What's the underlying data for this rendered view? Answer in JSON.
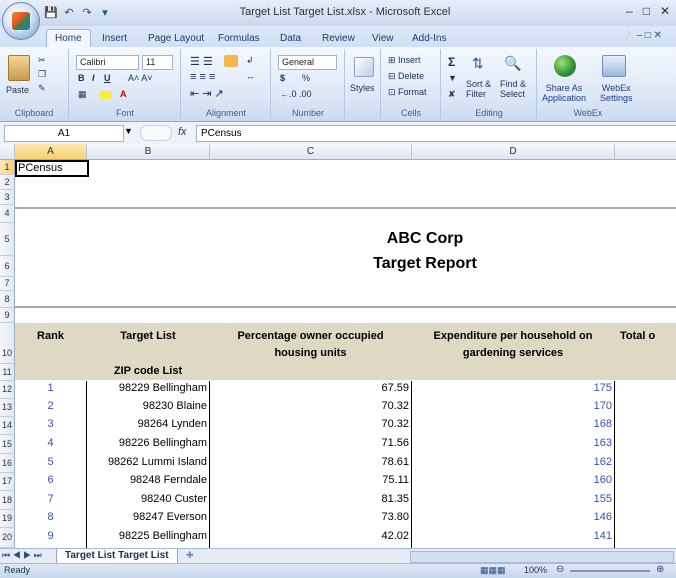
{
  "window": {
    "title": "Target List Target List.xlsx - Microsoft Excel"
  },
  "ribbon_tabs": [
    "Home",
    "Insert",
    "Page Layout",
    "Formulas",
    "Data",
    "Review",
    "View",
    "Add-Ins"
  ],
  "ribbon": {
    "clipboard": {
      "label": "Clipboard",
      "paste": "Paste"
    },
    "font": {
      "label": "Font",
      "name": "Calibri",
      "size": "11"
    },
    "alignment": {
      "label": "Alignment"
    },
    "number": {
      "label": "Number",
      "format": "General",
      "currency": "$",
      "percent": "%"
    },
    "styles": {
      "label": "Styles"
    },
    "cells": {
      "label": "Cells",
      "insert": "Insert",
      "delete": "Delete",
      "format": "Format"
    },
    "editing": {
      "label": "Editing",
      "sort": "Sort &",
      "filter": "Filter",
      "find": "Find &",
      "select": "Select"
    },
    "webex": {
      "label": "WebEx",
      "share": "Share As",
      "application": "Application",
      "webex": "WebEx",
      "settings": "Settings"
    }
  },
  "formula_bar": {
    "name_box": "A1",
    "fx": "fx",
    "formula": "PCensus"
  },
  "columns": [
    "A",
    "B",
    "C",
    "D"
  ],
  "row_numbers": [
    "1",
    "2",
    "3",
    "4",
    "5",
    "6",
    "7",
    "8",
    "9",
    "10",
    "11",
    "12",
    "13",
    "14",
    "15",
    "16",
    "17",
    "18",
    "19",
    "20"
  ],
  "sheet": {
    "a1": "PCensus",
    "report_title_1": "ABC Corp",
    "report_title_2": "Target Report",
    "headers": {
      "rank": "Rank",
      "target_list": "Target List",
      "zip_code_list": "ZIP code List",
      "pct_owner_1": "Percentage owner occupied",
      "pct_owner_2": "housing units",
      "exp_1": "Expenditure per household on",
      "exp_2": "gardening services",
      "total": "Total o"
    },
    "rows": [
      {
        "rank": "1",
        "zip": "98229 Bellingham",
        "pct": "67.59",
        "exp": "175"
      },
      {
        "rank": "2",
        "zip": "98230 Blaine",
        "pct": "70.32",
        "exp": "170"
      },
      {
        "rank": "3",
        "zip": "98264 Lynden",
        "pct": "70.32",
        "exp": "168"
      },
      {
        "rank": "4",
        "zip": "98226 Bellingham",
        "pct": "71.56",
        "exp": "163"
      },
      {
        "rank": "5",
        "zip": "98262 Lummi Island",
        "pct": "78.61",
        "exp": "162"
      },
      {
        "rank": "6",
        "zip": "98248 Ferndale",
        "pct": "75.11",
        "exp": "160"
      },
      {
        "rank": "7",
        "zip": "98240 Custer",
        "pct": "81.35",
        "exp": "155"
      },
      {
        "rank": "8",
        "zip": "98247 Everson",
        "pct": "73.80",
        "exp": "146"
      },
      {
        "rank": "9",
        "zip": "98225 Bellingham",
        "pct": "42.02",
        "exp": "141"
      }
    ]
  },
  "sheet_tab": "Target List Target List",
  "status": {
    "ready": "Ready",
    "zoom": "100%"
  },
  "colors": {
    "rank_blue": "#3a4fbf",
    "header_band": "#ddd9c3",
    "ribbon_blue": "#dbe7f6"
  }
}
